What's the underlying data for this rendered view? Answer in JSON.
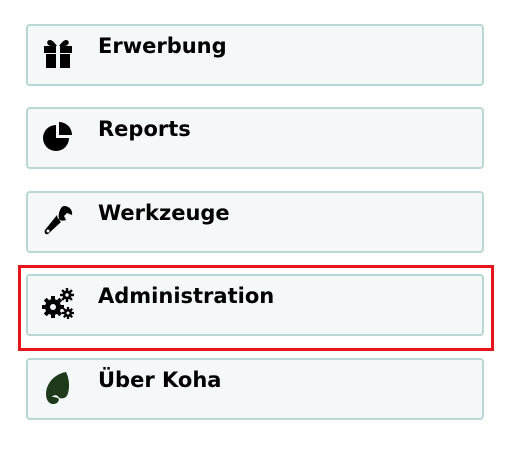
{
  "menu": {
    "items": [
      {
        "label": "Erwerbung",
        "icon": "gift-icon"
      },
      {
        "label": "Reports",
        "icon": "pie-chart-icon"
      },
      {
        "label": "Werkzeuge",
        "icon": "wrench-icon"
      },
      {
        "label": "Administration",
        "icon": "gears-icon"
      },
      {
        "label": "Über Koha",
        "icon": "koha-logo-icon"
      }
    ],
    "highlighted_item": "Administration",
    "colors": {
      "item_background": "#f4f8f9",
      "item_border": "#b9d7d3",
      "highlight_frame": "#e8141b",
      "koha_logo": "#1f3a1a"
    }
  }
}
